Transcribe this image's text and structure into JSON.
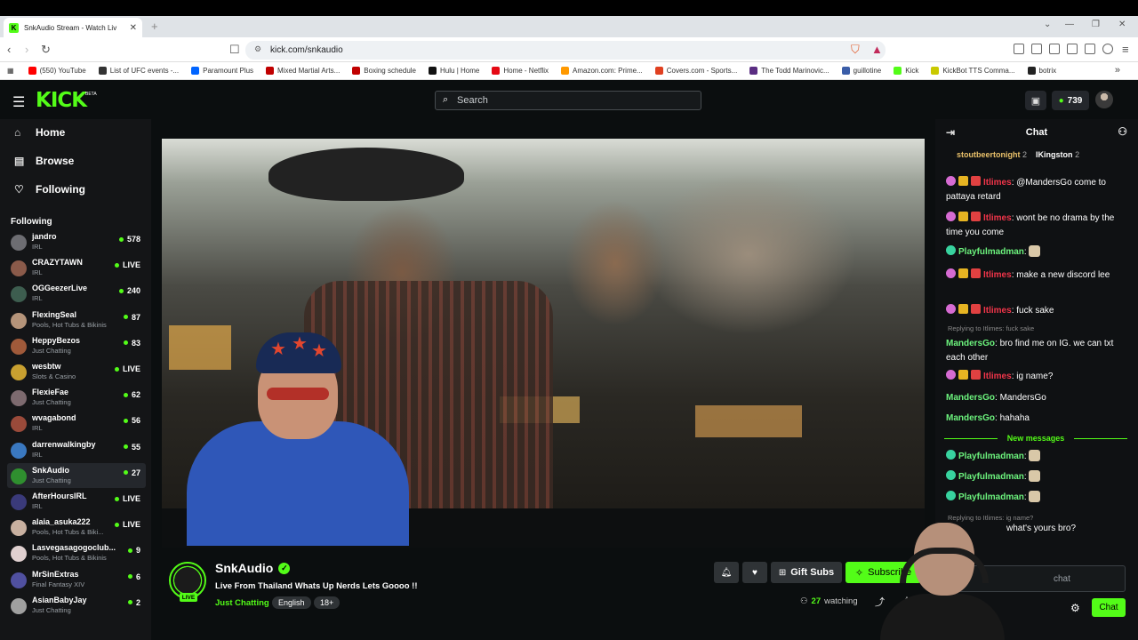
{
  "browser": {
    "tab_title": "SnkAudio Stream - Watch Liv",
    "url": "kick.com/snkaudio",
    "bookmarks": [
      {
        "label": "(550) YouTube",
        "color": "#ff0000"
      },
      {
        "label": "List of UFC events -...",
        "color": "#333333"
      },
      {
        "label": "Paramount Plus",
        "color": "#0064ff"
      },
      {
        "label": "Mixed Martial Arts...",
        "color": "#c00000"
      },
      {
        "label": "Boxing schedule",
        "color": "#c00000"
      },
      {
        "label": "Hulu | Home",
        "color": "#111111"
      },
      {
        "label": "Home - Netflix",
        "color": "#e50914"
      },
      {
        "label": "Amazon.com: Prime...",
        "color": "#ff9900"
      },
      {
        "label": "Covers.com - Sports...",
        "color": "#e04020"
      },
      {
        "label": "The Todd Marinovic...",
        "color": "#5a2d82"
      },
      {
        "label": "guillotine",
        "color": "#3a5da8"
      },
      {
        "label": "Kick",
        "color": "#53fc18"
      },
      {
        "label": "KickBot TTS Comma...",
        "color": "#c9c900"
      },
      {
        "label": "botrix",
        "color": "#222222"
      }
    ]
  },
  "header": {
    "logo": "KICK",
    "beta": "BETA",
    "search_placeholder": "Search",
    "points": "739"
  },
  "sidebar": {
    "nav": [
      {
        "label": "Home",
        "icon": "home-icon"
      },
      {
        "label": "Browse",
        "icon": "browse-icon"
      },
      {
        "label": "Following",
        "icon": "heart-icon"
      }
    ],
    "following_title": "Following",
    "following": [
      {
        "name": "jandro",
        "category": "IRL",
        "viewers": "578",
        "avatar": "#6d6d72"
      },
      {
        "name": "CRAZYTAWN",
        "category": "IRL",
        "viewers": "LIVE",
        "avatar": "#8a5a4a"
      },
      {
        "name": "OGGeezerLive",
        "category": "IRL",
        "viewers": "240",
        "avatar": "#3d5d4f"
      },
      {
        "name": "FlexingSeal",
        "category": "Pools, Hot Tubs & Bikinis",
        "viewers": "87",
        "avatar": "#b5947a"
      },
      {
        "name": "HeppyBezos",
        "category": "Just Chatting",
        "viewers": "83",
        "avatar": "#a05a3a"
      },
      {
        "name": "wesbtw",
        "category": "Slots & Casino",
        "viewers": "LIVE",
        "avatar": "#c8a030"
      },
      {
        "name": "FlexieFae",
        "category": "Just Chatting",
        "viewers": "62",
        "avatar": "#7d6a6f"
      },
      {
        "name": "wvagabond",
        "category": "IRL",
        "viewers": "56",
        "avatar": "#9a4a3a"
      },
      {
        "name": "darrenwalkingby",
        "category": "IRL",
        "viewers": "55",
        "avatar": "#3a78c0"
      },
      {
        "name": "SnkAudio",
        "category": "Just Chatting",
        "viewers": "27",
        "avatar": "#2f8f2f"
      },
      {
        "name": "AfterHoursIRL",
        "category": "IRL",
        "viewers": "LIVE",
        "avatar": "#3a3a7a"
      },
      {
        "name": "alaia_asuka222",
        "category": "Pools, Hot Tubs & Biki...",
        "viewers": "LIVE",
        "avatar": "#c8b0a0"
      },
      {
        "name": "Lasvegasagogoclub...",
        "category": "Pools, Hot Tubs & Bikinis",
        "viewers": "9",
        "avatar": "#e0d0d0"
      },
      {
        "name": "MrSinExtras",
        "category": "Final Fantasy XIV",
        "viewers": "6",
        "avatar": "#5050a0"
      },
      {
        "name": "AsianBabyJay",
        "category": "Just Chatting",
        "viewers": "2",
        "avatar": "#a0a0a0"
      }
    ],
    "active_index": 9
  },
  "stream": {
    "channel": "SnkAudio",
    "live_badge": "LIVE",
    "title": "Live From Thailand Whats Up Nerds Lets Goooo !!",
    "category": "Just Chatting",
    "tags": [
      "English",
      "18+"
    ],
    "gift_subs": "Gift Subs",
    "subscribe": "Subscribe",
    "watching_count": "27",
    "watching_label": "watching"
  },
  "chat": {
    "title": "Chat",
    "pinned": "stoutbeertonight",
    "pinned_count": "2",
    "pinned2": "IKingston",
    "pinned2_count": "2",
    "messages": [
      {
        "user": "Itlimes",
        "color": "red",
        "badges": [
          "sub",
          "crown",
          "gift"
        ],
        "text": "@MandersGo come to pattaya retard"
      },
      {
        "user": "Itlimes",
        "color": "red",
        "badges": [
          "sub",
          "crown",
          "gift"
        ],
        "text": "wont be no drama by the time you come"
      },
      {
        "user": "Playfulmadman",
        "color": "green",
        "badges": [
          "g35"
        ],
        "text": "",
        "emote": true
      },
      {
        "user": "Itlimes",
        "color": "red",
        "badges": [
          "sub",
          "crown",
          "gift"
        ],
        "text": "make a new discord lee"
      },
      {
        "user": "Itlimes",
        "color": "red",
        "badges": [
          "sub",
          "crown",
          "gift"
        ],
        "text": "fuck sake"
      },
      {
        "reply": "Replying to Itlimes: fuck sake",
        "user": "MandersGo",
        "color": "green",
        "badges": [],
        "text": "bro find me on IG. we can txt each other"
      },
      {
        "user": "Itlimes",
        "color": "red",
        "badges": [
          "sub",
          "crown",
          "gift"
        ],
        "text": "ig name?"
      },
      {
        "user": "MandersGo",
        "color": "green",
        "badges": [],
        "text": "MandersGo"
      },
      {
        "user": "MandersGo",
        "color": "green",
        "badges": [],
        "text": "hahaha"
      }
    ],
    "new_messages": "New messages",
    "new": [
      {
        "user": "Playfulmadman",
        "text": ""
      },
      {
        "user": "Playfulmadman",
        "text": ""
      },
      {
        "user": "Playfulmadman",
        "text": ""
      }
    ],
    "last_reply": "Replying to Itlimes: ig name?",
    "last_text": "what's yours bro?",
    "input_placeholder": "chat",
    "send_label": "Chat"
  }
}
